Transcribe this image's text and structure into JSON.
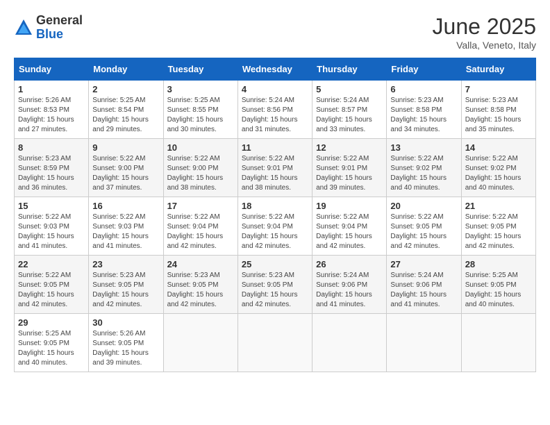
{
  "header": {
    "logo_general": "General",
    "logo_blue": "Blue",
    "month": "June 2025",
    "location": "Valla, Veneto, Italy"
  },
  "columns": [
    "Sunday",
    "Monday",
    "Tuesday",
    "Wednesday",
    "Thursday",
    "Friday",
    "Saturday"
  ],
  "weeks": [
    [
      {
        "day": "1",
        "sunrise": "Sunrise: 5:26 AM",
        "sunset": "Sunset: 8:53 PM",
        "daylight": "Daylight: 15 hours and 27 minutes."
      },
      {
        "day": "2",
        "sunrise": "Sunrise: 5:25 AM",
        "sunset": "Sunset: 8:54 PM",
        "daylight": "Daylight: 15 hours and 29 minutes."
      },
      {
        "day": "3",
        "sunrise": "Sunrise: 5:25 AM",
        "sunset": "Sunset: 8:55 PM",
        "daylight": "Daylight: 15 hours and 30 minutes."
      },
      {
        "day": "4",
        "sunrise": "Sunrise: 5:24 AM",
        "sunset": "Sunset: 8:56 PM",
        "daylight": "Daylight: 15 hours and 31 minutes."
      },
      {
        "day": "5",
        "sunrise": "Sunrise: 5:24 AM",
        "sunset": "Sunset: 8:57 PM",
        "daylight": "Daylight: 15 hours and 33 minutes."
      },
      {
        "day": "6",
        "sunrise": "Sunrise: 5:23 AM",
        "sunset": "Sunset: 8:58 PM",
        "daylight": "Daylight: 15 hours and 34 minutes."
      },
      {
        "day": "7",
        "sunrise": "Sunrise: 5:23 AM",
        "sunset": "Sunset: 8:58 PM",
        "daylight": "Daylight: 15 hours and 35 minutes."
      }
    ],
    [
      {
        "day": "8",
        "sunrise": "Sunrise: 5:23 AM",
        "sunset": "Sunset: 8:59 PM",
        "daylight": "Daylight: 15 hours and 36 minutes."
      },
      {
        "day": "9",
        "sunrise": "Sunrise: 5:22 AM",
        "sunset": "Sunset: 9:00 PM",
        "daylight": "Daylight: 15 hours and 37 minutes."
      },
      {
        "day": "10",
        "sunrise": "Sunrise: 5:22 AM",
        "sunset": "Sunset: 9:00 PM",
        "daylight": "Daylight: 15 hours and 38 minutes."
      },
      {
        "day": "11",
        "sunrise": "Sunrise: 5:22 AM",
        "sunset": "Sunset: 9:01 PM",
        "daylight": "Daylight: 15 hours and 38 minutes."
      },
      {
        "day": "12",
        "sunrise": "Sunrise: 5:22 AM",
        "sunset": "Sunset: 9:01 PM",
        "daylight": "Daylight: 15 hours and 39 minutes."
      },
      {
        "day": "13",
        "sunrise": "Sunrise: 5:22 AM",
        "sunset": "Sunset: 9:02 PM",
        "daylight": "Daylight: 15 hours and 40 minutes."
      },
      {
        "day": "14",
        "sunrise": "Sunrise: 5:22 AM",
        "sunset": "Sunset: 9:02 PM",
        "daylight": "Daylight: 15 hours and 40 minutes."
      }
    ],
    [
      {
        "day": "15",
        "sunrise": "Sunrise: 5:22 AM",
        "sunset": "Sunset: 9:03 PM",
        "daylight": "Daylight: 15 hours and 41 minutes."
      },
      {
        "day": "16",
        "sunrise": "Sunrise: 5:22 AM",
        "sunset": "Sunset: 9:03 PM",
        "daylight": "Daylight: 15 hours and 41 minutes."
      },
      {
        "day": "17",
        "sunrise": "Sunrise: 5:22 AM",
        "sunset": "Sunset: 9:04 PM",
        "daylight": "Daylight: 15 hours and 42 minutes."
      },
      {
        "day": "18",
        "sunrise": "Sunrise: 5:22 AM",
        "sunset": "Sunset: 9:04 PM",
        "daylight": "Daylight: 15 hours and 42 minutes."
      },
      {
        "day": "19",
        "sunrise": "Sunrise: 5:22 AM",
        "sunset": "Sunset: 9:04 PM",
        "daylight": "Daylight: 15 hours and 42 minutes."
      },
      {
        "day": "20",
        "sunrise": "Sunrise: 5:22 AM",
        "sunset": "Sunset: 9:05 PM",
        "daylight": "Daylight: 15 hours and 42 minutes."
      },
      {
        "day": "21",
        "sunrise": "Sunrise: 5:22 AM",
        "sunset": "Sunset: 9:05 PM",
        "daylight": "Daylight: 15 hours and 42 minutes."
      }
    ],
    [
      {
        "day": "22",
        "sunrise": "Sunrise: 5:22 AM",
        "sunset": "Sunset: 9:05 PM",
        "daylight": "Daylight: 15 hours and 42 minutes."
      },
      {
        "day": "23",
        "sunrise": "Sunrise: 5:23 AM",
        "sunset": "Sunset: 9:05 PM",
        "daylight": "Daylight: 15 hours and 42 minutes."
      },
      {
        "day": "24",
        "sunrise": "Sunrise: 5:23 AM",
        "sunset": "Sunset: 9:05 PM",
        "daylight": "Daylight: 15 hours and 42 minutes."
      },
      {
        "day": "25",
        "sunrise": "Sunrise: 5:23 AM",
        "sunset": "Sunset: 9:05 PM",
        "daylight": "Daylight: 15 hours and 42 minutes."
      },
      {
        "day": "26",
        "sunrise": "Sunrise: 5:24 AM",
        "sunset": "Sunset: 9:06 PM",
        "daylight": "Daylight: 15 hours and 41 minutes."
      },
      {
        "day": "27",
        "sunrise": "Sunrise: 5:24 AM",
        "sunset": "Sunset: 9:06 PM",
        "daylight": "Daylight: 15 hours and 41 minutes."
      },
      {
        "day": "28",
        "sunrise": "Sunrise: 5:25 AM",
        "sunset": "Sunset: 9:05 PM",
        "daylight": "Daylight: 15 hours and 40 minutes."
      }
    ],
    [
      {
        "day": "29",
        "sunrise": "Sunrise: 5:25 AM",
        "sunset": "Sunset: 9:05 PM",
        "daylight": "Daylight: 15 hours and 40 minutes."
      },
      {
        "day": "30",
        "sunrise": "Sunrise: 5:26 AM",
        "sunset": "Sunset: 9:05 PM",
        "daylight": "Daylight: 15 hours and 39 minutes."
      },
      null,
      null,
      null,
      null,
      null
    ]
  ]
}
